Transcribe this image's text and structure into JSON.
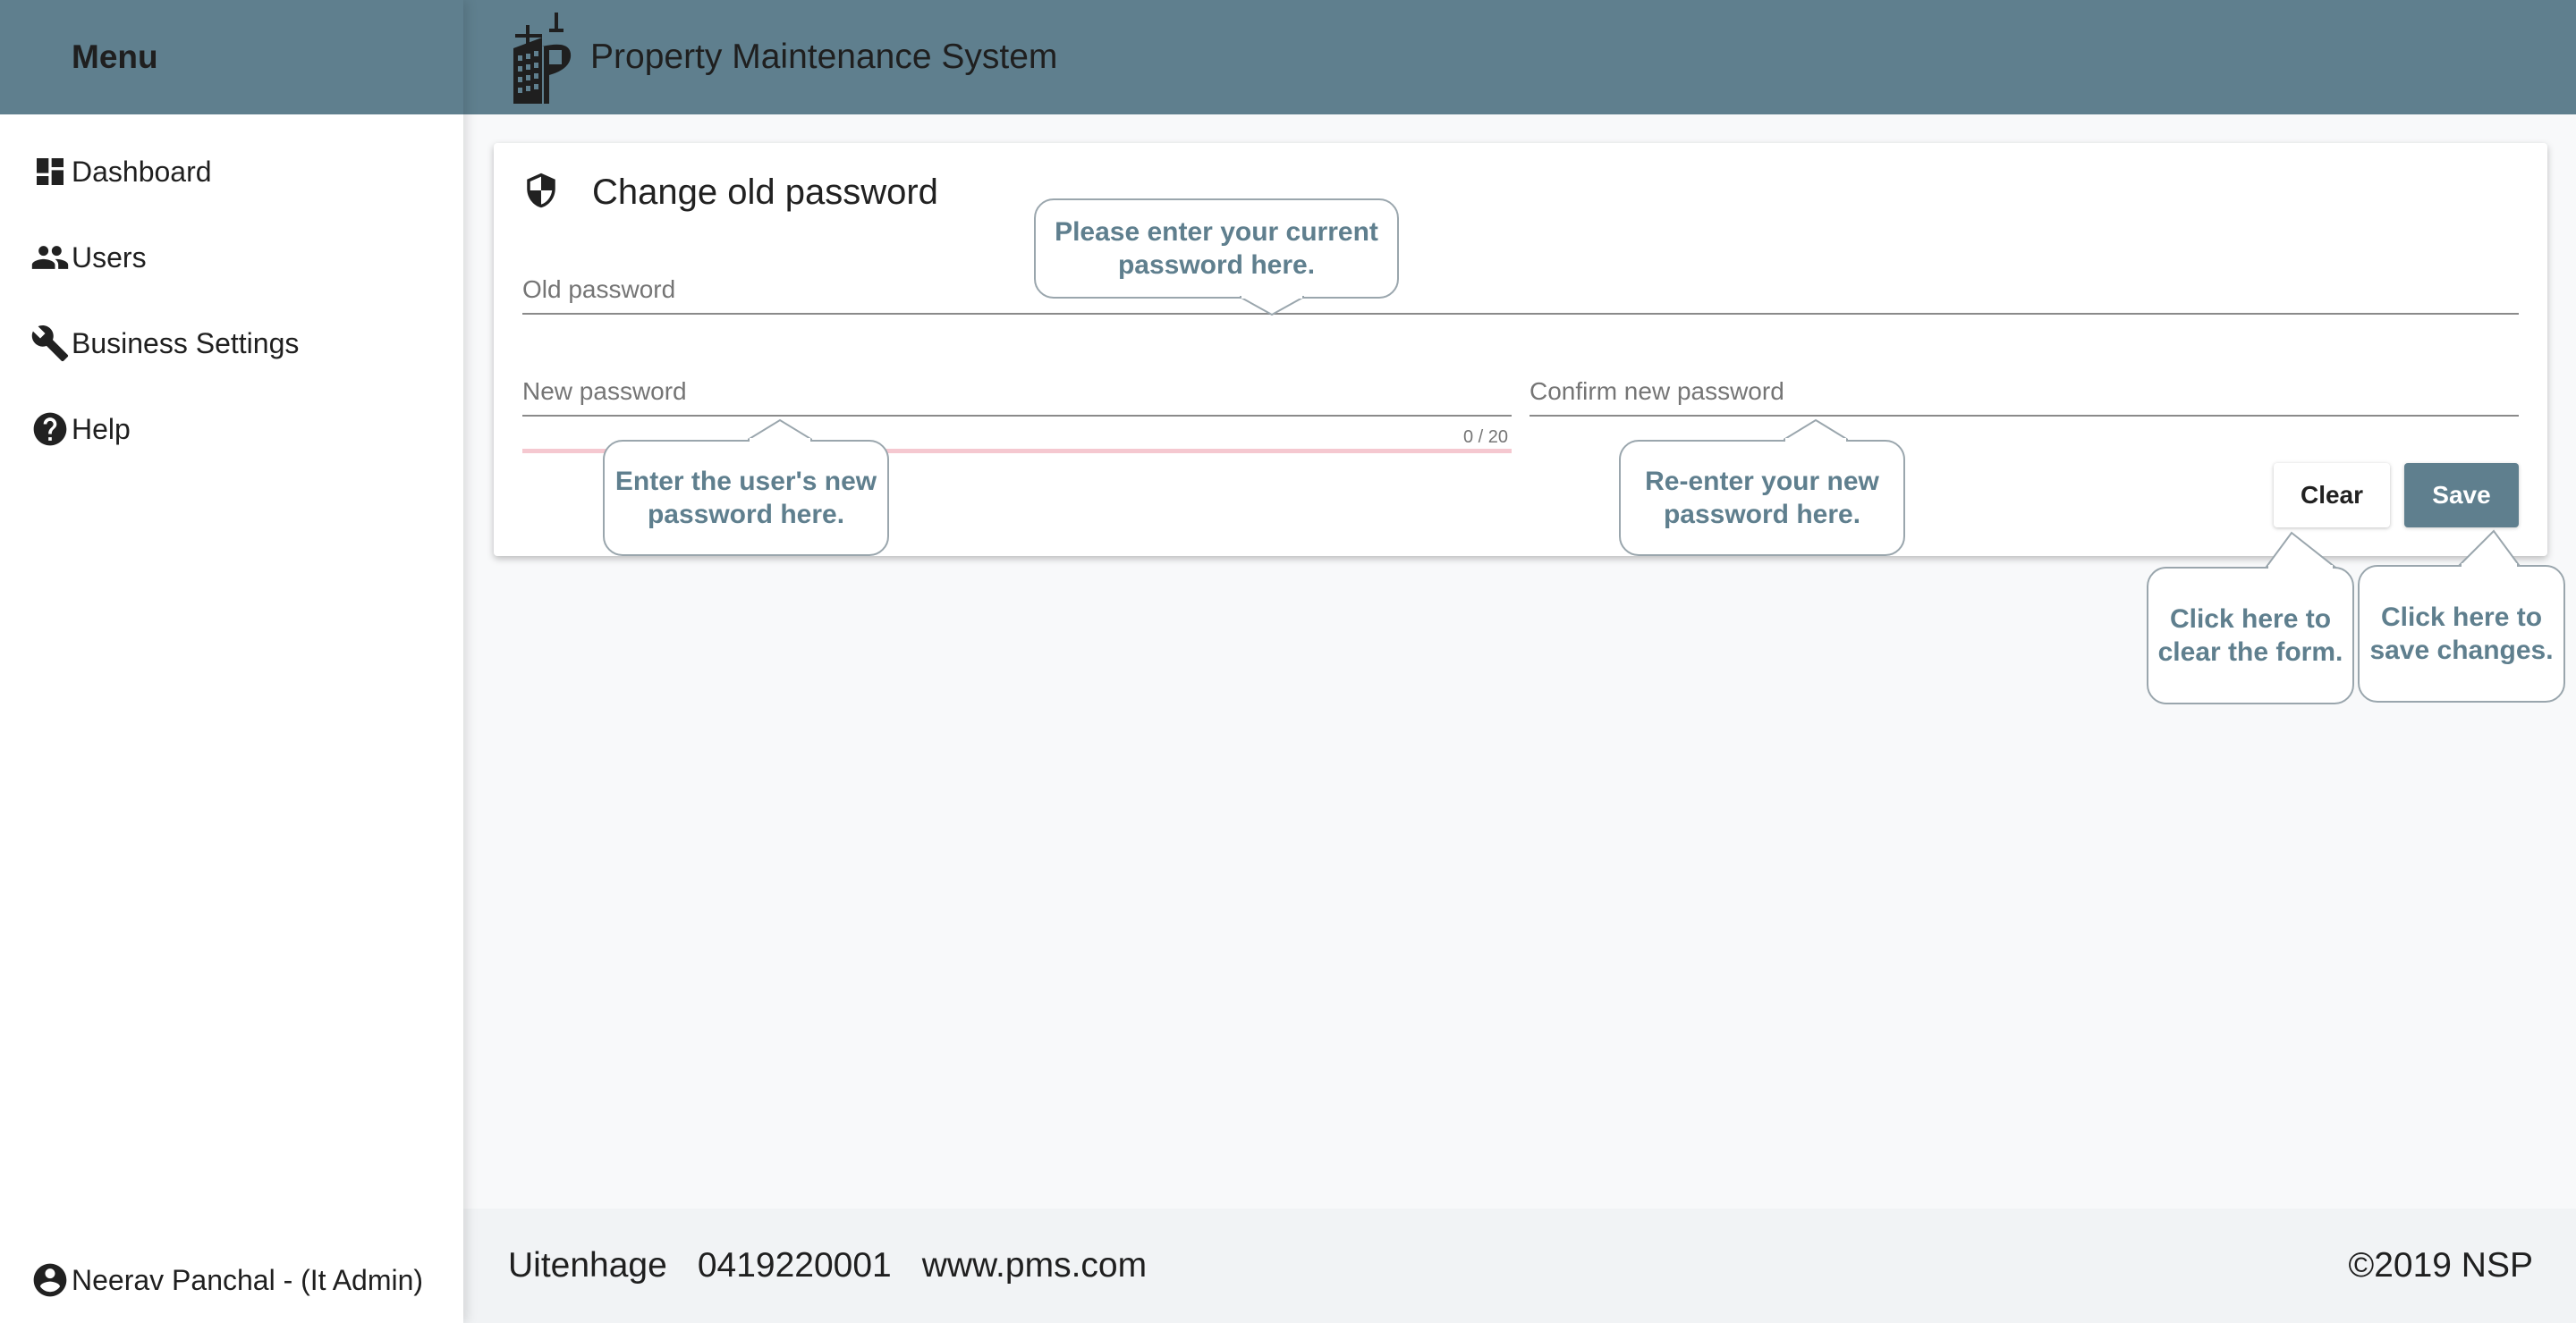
{
  "sidebar": {
    "title": "Menu",
    "items": [
      {
        "label": "Dashboard",
        "icon": "dashboard-icon"
      },
      {
        "label": "Users",
        "icon": "users-icon"
      },
      {
        "label": "Business Settings",
        "icon": "wrench-icon"
      },
      {
        "label": "Help",
        "icon": "help-icon"
      }
    ],
    "user": "Neerav Panchal - (It Admin)"
  },
  "header": {
    "title": "Property Maintenance System"
  },
  "form": {
    "title": "Change old password",
    "old_password_label": "Old password",
    "new_password_label": "New password",
    "confirm_password_label": "Confirm new password",
    "counter": "0 / 20",
    "clear_label": "Clear",
    "save_label": "Save"
  },
  "tooltips": {
    "old_password": "Please enter your current password here.",
    "new_password": "Enter the user's new password here.",
    "confirm_password": "Re-enter your new password here.",
    "clear": "Click here to clear the form.",
    "save": "Click here to save changes."
  },
  "footer": {
    "city": "Uitenhage",
    "phone": "0419220001",
    "website": "www.pms.com",
    "copyright": "©2019 NSP"
  },
  "colors": {
    "primary": "#5f7f8e",
    "tooltip_text": "#5f7f8e",
    "counter_bar": "#f5c8d0"
  }
}
